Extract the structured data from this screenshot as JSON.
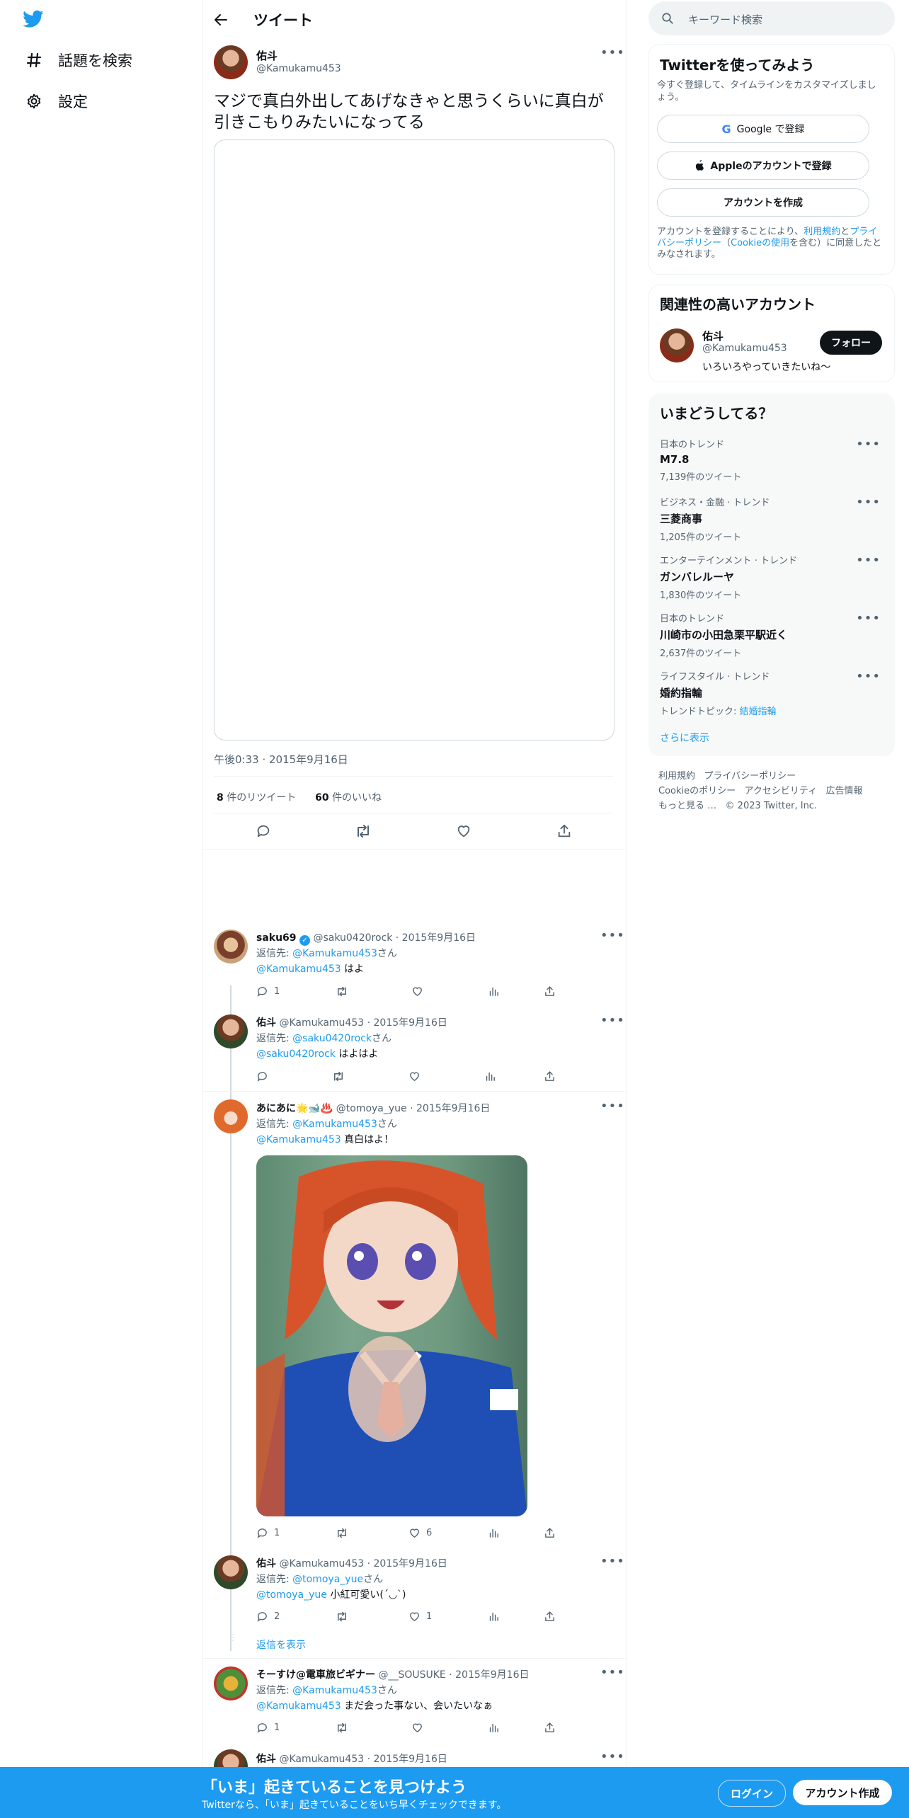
{
  "nav": {
    "explore_label": "話題を検索",
    "settings_label": "設定"
  },
  "header": {
    "title": "ツイート"
  },
  "tweet": {
    "name": "佑斗",
    "handle": "@Kamukamu453",
    "text": "マジで真白外出してあげなきゃと思うくらいに真白が引きこもりみたいになってる",
    "time": "午後0:33 · 2015年9月16日",
    "retweets": "8",
    "retweets_label": "件のリツイート",
    "likes": "60",
    "likes_label": "件のいいね"
  },
  "replies": [
    {
      "name": "saku69",
      "verified": true,
      "handle": "@saku0420rock",
      "date": "· 2015年9月16日",
      "reply_to_prefix": "返信先: ",
      "reply_to": "@Kamukamu453",
      "reply_to_suffix": "さん",
      "mention": "@Kamukamu453",
      "text": " はよ",
      "counts": {
        "reply": "1",
        "retweet": "",
        "like": ""
      }
    },
    {
      "name": "佑斗",
      "handle": "@Kamukamu453",
      "date": "· 2015年9月16日",
      "reply_to_prefix": "返信先: ",
      "reply_to": "@saku0420rock",
      "reply_to_suffix": "さん",
      "mention": "@saku0420rock",
      "text": " はよはよ",
      "counts": {
        "reply": "",
        "retweet": "",
        "like": ""
      }
    },
    {
      "name": "あにあに🌟🐋♨️",
      "handle": "@tomoya_yue",
      "date": "· 2015年9月16日",
      "reply_to_prefix": "返信先: ",
      "reply_to": "@Kamukamu453",
      "reply_to_suffix": "さん",
      "mention": "@Kamukamu453",
      "text": " 真白はよ！",
      "counts": {
        "reply": "1",
        "retweet": "",
        "like": "6"
      }
    },
    {
      "name": "佑斗",
      "handle": "@Kamukamu453",
      "date": "· 2015年9月16日",
      "reply_to_prefix": "返信先: ",
      "reply_to": "@tomoya_yue",
      "reply_to_suffix": "さん",
      "mention": "@tomoya_yue",
      "text": " 小紅可愛い(´◡`)",
      "counts": {
        "reply": "2",
        "retweet": "",
        "like": "1"
      }
    },
    {
      "name": "そーすけ@電車旅ビギナー",
      "handle": "@__SOUSUKE",
      "date": "· 2015年9月16日",
      "reply_to_prefix": "返信先: ",
      "reply_to": "@Kamukamu453",
      "reply_to_suffix": "さん",
      "mention": "@Kamukamu453",
      "text": " まだ会った事ない、会いたいなぁ",
      "counts": {
        "reply": "1",
        "retweet": "",
        "like": ""
      }
    },
    {
      "name": "佑斗",
      "handle": "@Kamukamu453",
      "date": "· 2015年9月16日"
    }
  ],
  "show_replies_label": "返信を表示",
  "right": {
    "search_placeholder": "キーワード検索",
    "signup": {
      "title": "Twitterを使ってみよう",
      "subtitle": "今すぐ登録して、タイムラインをカスタマイズしましょう。",
      "google_label": "Google で登録",
      "apple_label": "Appleのアカウントで登録",
      "create_label": "アカウントを作成",
      "legal_prefix": "アカウントを登録することにより、",
      "legal_terms": "利用規約",
      "legal_and": "と",
      "legal_privacy": "プライバシーポリシー",
      "legal_paren_open": "（",
      "legal_cookie": "Cookieの使用",
      "legal_suffix": "を含む）に同意したとみなされます。"
    },
    "related": {
      "title": "関連性の高いアカウント",
      "name": "佑斗",
      "handle": "@Kamukamu453",
      "bio": "いろいろやっていきたいね〜",
      "follow_label": "フォロー"
    },
    "trends": {
      "title": "いまどうしてる？",
      "items": [
        {
          "category": "日本のトレンド",
          "name": "M7.8",
          "count": "7,139件のツイート"
        },
        {
          "category": "ビジネス・金融 · トレンド",
          "name": "三菱商事",
          "count": "1,205件のツイート"
        },
        {
          "category": "エンターテインメント · トレンド",
          "name": "ガンバレルーヤ",
          "count": "1,830件のツイート"
        },
        {
          "category": "日本のトレンド",
          "name": "川崎市の小田急栗平駅近く",
          "count": "2,637件のツイート"
        },
        {
          "category": "ライフスタイル · トレンド",
          "name": "婚約指輪",
          "topic_prefix": "トレンドトピック: ",
          "topic": "結婚指輪"
        }
      ],
      "show_more": "さらに表示"
    },
    "footer": {
      "terms": "利用規約",
      "privacy": "プライバシーポリシー",
      "cookie": "Cookieのポリシー",
      "accessibility": "アクセシビリティ",
      "ads": "広告情報",
      "more": "もっと見る …",
      "copyright": "© 2023 Twitter, Inc."
    }
  },
  "banner": {
    "title": "「いま」起きていることを見つけよう",
    "subtitle": "Twitterなら、「いま」起きていることをいち早くチェックできます。",
    "login_label": "ログイン",
    "signup_label": "アカウント作成"
  },
  "colors": {
    "accent": "#1d9bf0",
    "text": "#0f1419",
    "muted": "#536471"
  }
}
